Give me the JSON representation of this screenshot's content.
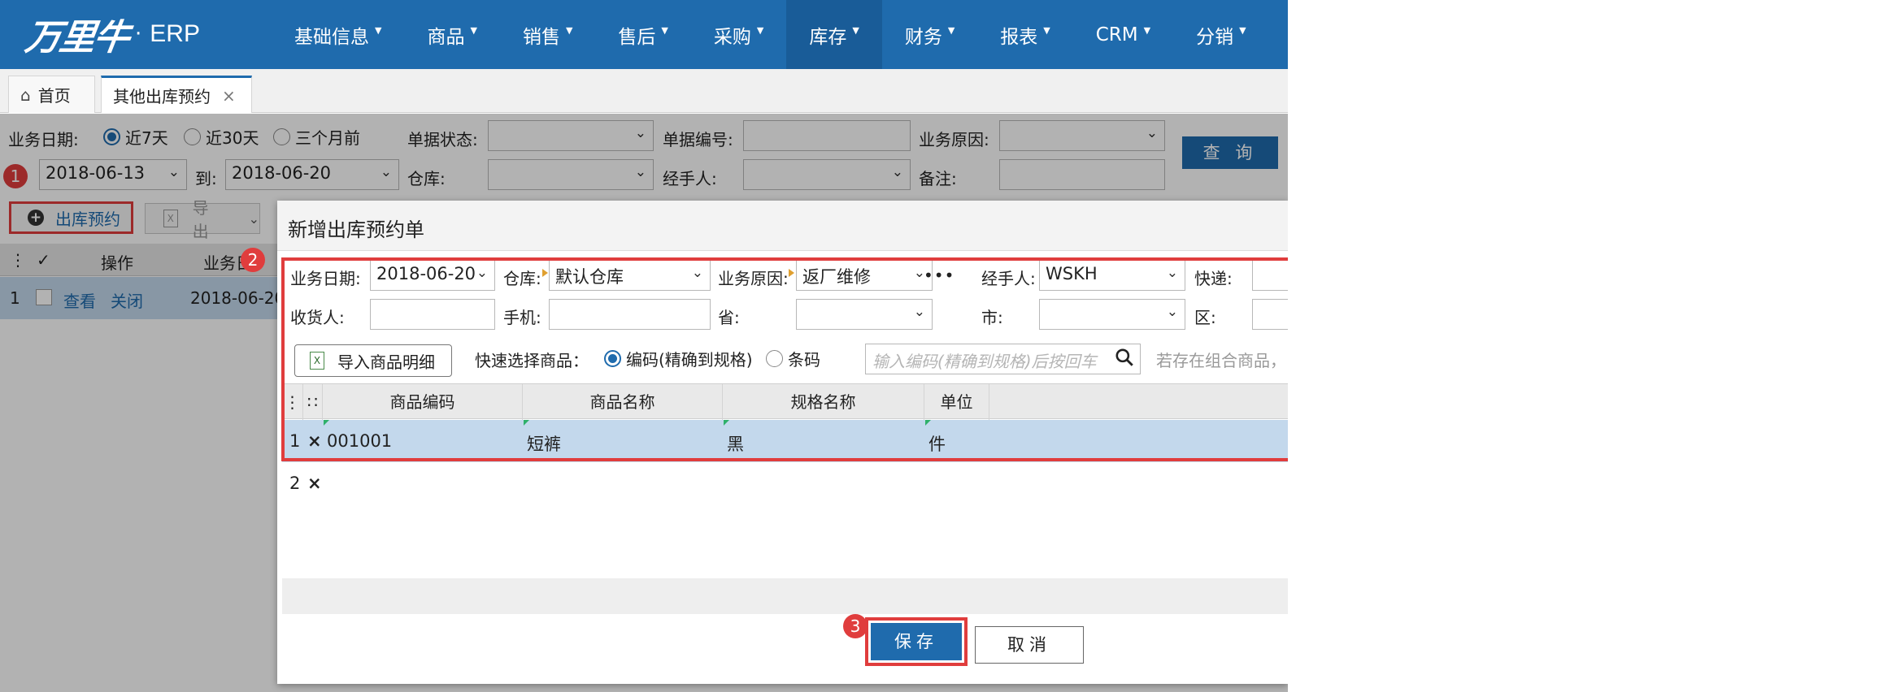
{
  "app": {
    "brand": "万里牛",
    "dot": "·",
    "product": "ERP"
  },
  "nav": [
    {
      "label": "基础信息",
      "active": false
    },
    {
      "label": "商品",
      "active": false
    },
    {
      "label": "销售",
      "active": false
    },
    {
      "label": "售后",
      "active": false
    },
    {
      "label": "采购",
      "active": false
    },
    {
      "label": "库存",
      "active": true
    },
    {
      "label": "财务",
      "active": false
    },
    {
      "label": "报表",
      "active": false
    },
    {
      "label": "CRM",
      "active": false
    },
    {
      "label": "分销",
      "active": false
    }
  ],
  "tabs": {
    "home": "首页",
    "current": "其他出库预约",
    "close": "×"
  },
  "filters": {
    "biz_date_label": "业务日期:",
    "radio_7d": "近7天",
    "radio_30d": "近30天",
    "radio_3m": "三个月前",
    "date_from": "2018-06-13",
    "to_label": "到:",
    "date_to": "2018-06-20",
    "doc_status_label": "单据状态:",
    "doc_status_value": "",
    "doc_no_label": "单据编号:",
    "doc_no_value": "",
    "biz_reason_label": "业务原因:",
    "biz_reason_value": "",
    "warehouse_label": "仓库:",
    "warehouse_value": "",
    "handler_label": "经手人:",
    "handler_value": "",
    "remark_label": "备注:",
    "remark_value": "",
    "query_button": "查 询"
  },
  "toolbar": {
    "reserve_button": "出库预约",
    "export_button": "导出"
  },
  "badges": [
    "1",
    "2",
    "3"
  ],
  "grid": {
    "headers": [
      "操作",
      "业务日"
    ],
    "row": {
      "index": "1",
      "view": "查看",
      "close": "关闭",
      "date": "2018-06-20"
    }
  },
  "dialog": {
    "title": "新增出库预约单",
    "biz_date_label": "业务日期:",
    "biz_date_value": "2018-06-20",
    "warehouse_label": "仓库:",
    "warehouse_value": "默认仓库",
    "biz_reason_label": "业务原因:",
    "biz_reason_value": "返厂维修",
    "more_dots": "•••",
    "handler_label": "经手人:",
    "handler_value": "WSKH",
    "express_label": "快递:",
    "express_value": "",
    "consignee_label": "收货人:",
    "consignee_value": "",
    "phone_label": "手机:",
    "phone_value": "",
    "province_label": "省:",
    "province_value": "",
    "city_label": "市:",
    "city_value": "",
    "district_label": "区:",
    "district_value": "",
    "import_button": "导入商品明细",
    "quick_select_label": "快速选择商品：",
    "radio_code": "编码(精确到规格)",
    "radio_barcode": "条码",
    "search_placeholder": "输入编码(精确到规格)后按回车",
    "hint": "若存在组合商品，",
    "columns": [
      "商品编码",
      "商品名称",
      "规格名称",
      "单位"
    ],
    "rows": [
      {
        "index": "1",
        "del": "×",
        "code": "001001",
        "name": "短裤",
        "spec": "黑",
        "unit": "件"
      },
      {
        "index": "2",
        "del": "×",
        "code": "",
        "name": "",
        "spec": "",
        "unit": ""
      }
    ],
    "save_button": "保存",
    "cancel_button": "取消"
  },
  "colors": {
    "primary": "#1f6bad",
    "highlight_red": "#e03d3d",
    "row_selected": "#c3d8ec"
  }
}
